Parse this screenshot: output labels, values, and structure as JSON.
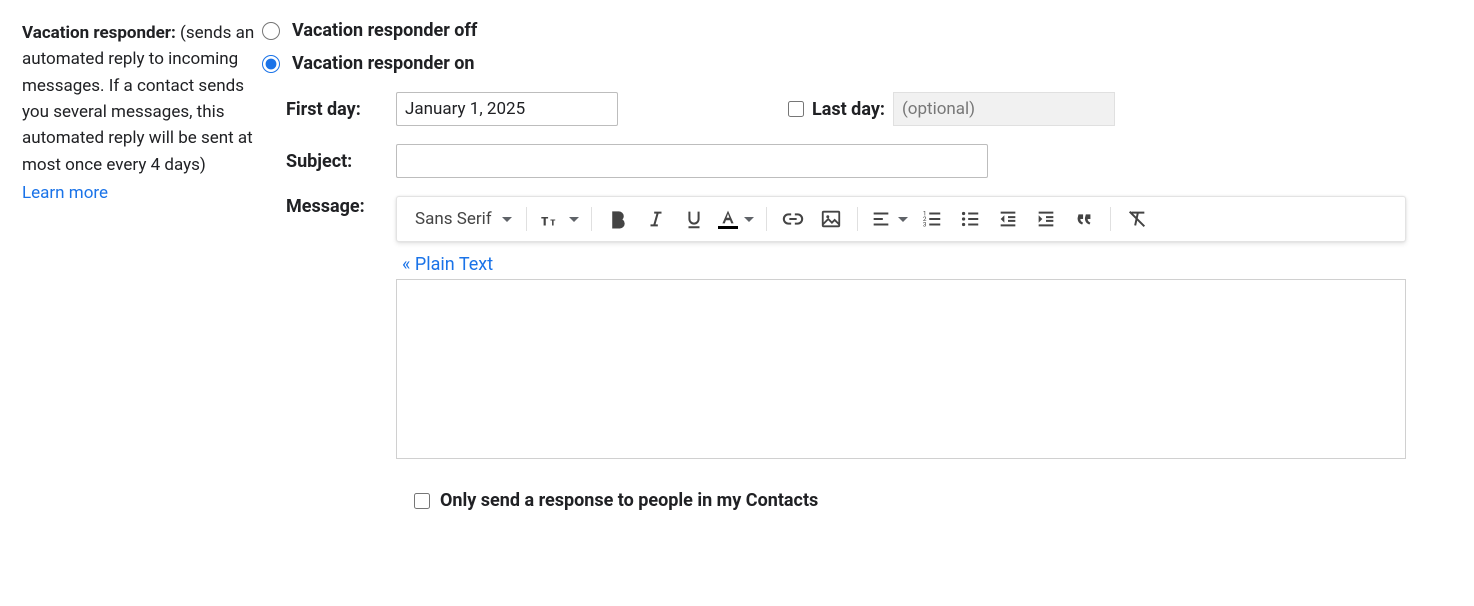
{
  "section": {
    "title": "Vacation responder:",
    "description": "(sends an automated reply to incoming messages. If a contact sends you several messages, this automated reply will be sent at most once every 4 days)",
    "learn_more": "Learn more"
  },
  "radio": {
    "off_label": "Vacation responder off",
    "on_label": "Vacation responder on",
    "selected": "on"
  },
  "dates": {
    "first_day_label": "First day:",
    "first_day_value": "January 1, 2025",
    "last_day_label": "Last day:",
    "last_day_placeholder": "(optional)",
    "last_day_enabled": false
  },
  "subject": {
    "label": "Subject:",
    "value": ""
  },
  "message": {
    "label": "Message:",
    "font_label": "Sans Serif",
    "plain_text_link": "« Plain Text",
    "body": ""
  },
  "contacts_only": {
    "label": "Only send a response to people in my Contacts",
    "checked": false
  }
}
